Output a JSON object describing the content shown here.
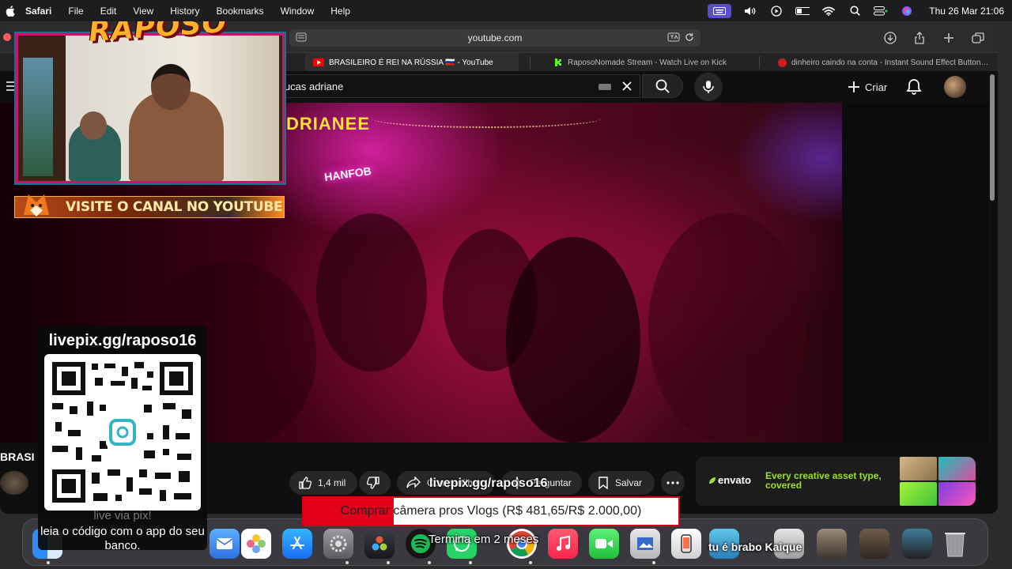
{
  "menubar": {
    "app_name": "Safari",
    "items": [
      "File",
      "Edit",
      "View",
      "History",
      "Bookmarks",
      "Window",
      "Help"
    ],
    "clock": "Thu 26 Mar  21:06"
  },
  "browser": {
    "url": "youtube.com",
    "tabs": [
      {
        "title": "BRASILEIRO É REI NA RÚSSIA 🇷🇺 - YouTube",
        "favicon_color": "#ff0000",
        "active": true
      },
      {
        "title": "RaposoNomade Stream - Watch Live on Kick",
        "favicon_color": "#53fc18",
        "active": false
      },
      {
        "title": "dinheiro caindo na conta - Instant Sound Effect Button…",
        "favicon_color": "#d01d1d",
        "active": false
      }
    ]
  },
  "youtube": {
    "search_value": "lucas adriane",
    "create_label": "Criar",
    "video_overlay_title": "DRIANEE",
    "neon_sign": "HANFOB",
    "channel_text": "BRASI",
    "actions": {
      "likes": "1,4 mil",
      "share_label": "Compartilhar",
      "clip_label": "Perguntar",
      "save_label": "Salvar"
    },
    "ad": {
      "brand": "envato",
      "tagline": "Every creative asset type, covered",
      "brand_color": "#9ce02e"
    }
  },
  "overlay": {
    "logo": "RAPOSO",
    "visit_banner": "VISITE O CANAL NO YOUTUBE",
    "pix_url": "livepix.gg/raposo16",
    "pix_caption1": "live via pix!",
    "pix_caption2": "leia o código com o app do seu banco.",
    "goal_url": "livepix.gg/raposo16",
    "goal_label": "Comprar câmera pros Vlogs (R$ 481,65/R$ 2.000,00)",
    "goal_progress": 0.24,
    "goal_time": "Termina em 2 meses",
    "chat_message": "tu é brabo Kaique"
  },
  "dock": {
    "apps": [
      "finder-icon",
      "launchpad-icon",
      "safari-icon",
      "messages-icon",
      "mail-icon",
      "photos-icon",
      "app-store-icon",
      "system-settings-icon",
      "davinci-resolve-icon",
      "spotify-icon",
      "whatsapp-icon",
      "chrome-icon",
      "music-icon",
      "facetime-icon",
      "preview-icon",
      "iphone-mirroring-icon",
      "notes-icon",
      "downloads-icon",
      "folder-icon",
      "screenshot-icon",
      "window-icon",
      "trash-icon"
    ]
  },
  "colors": {
    "accent_magenta": "#c6156b",
    "goal_red": "#e4001a",
    "title_yellow": "#ffe234"
  }
}
